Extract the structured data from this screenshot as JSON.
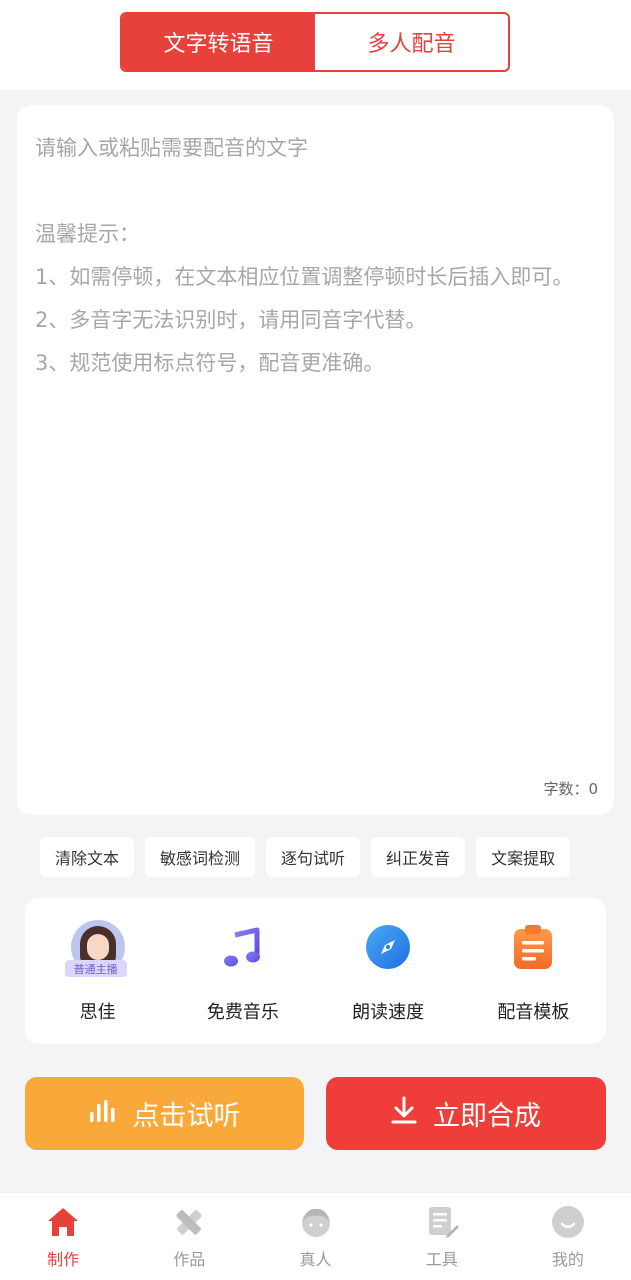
{
  "segment": {
    "tabs": [
      {
        "label": "文字转语音",
        "active": true
      },
      {
        "label": "多人配音",
        "active": false
      }
    ]
  },
  "editor": {
    "placeholder": "请输入或粘贴需要配音的文字\n\n温馨提示：\n1、如需停顿，在文本相应位置调整停顿时长后插入即可。\n2、多音字无法识别时，请用同音字代替。\n3、规范使用标点符号，配音更准确。",
    "word_count": "字数：0"
  },
  "tools": [
    "清除文本",
    "敏感词检测",
    "逐句试听",
    "纠正发音",
    "文案提取"
  ],
  "options": {
    "voice": {
      "label": "思佳",
      "badge": "普通主播"
    },
    "music": {
      "label": "免费音乐"
    },
    "speed": {
      "label": "朗读速度"
    },
    "template": {
      "label": "配音模板"
    }
  },
  "actions": {
    "listen": "点击试听",
    "synthesize": "立即合成"
  },
  "tabbar": {
    "items": [
      {
        "label": "制作",
        "icon": "home-icon",
        "active": true
      },
      {
        "label": "作品",
        "icon": "pencil-ruler-icon",
        "active": false
      },
      {
        "label": "真人",
        "icon": "person-icon",
        "active": false
      },
      {
        "label": "工具",
        "icon": "document-edit-icon",
        "active": false
      },
      {
        "label": "我的",
        "icon": "profile-icon",
        "active": false
      }
    ]
  },
  "colors": {
    "primary": "#e8413c",
    "listen_button": "#f9a93a",
    "synth_button": "#ef3e3a",
    "background": "#f4f4f6"
  }
}
